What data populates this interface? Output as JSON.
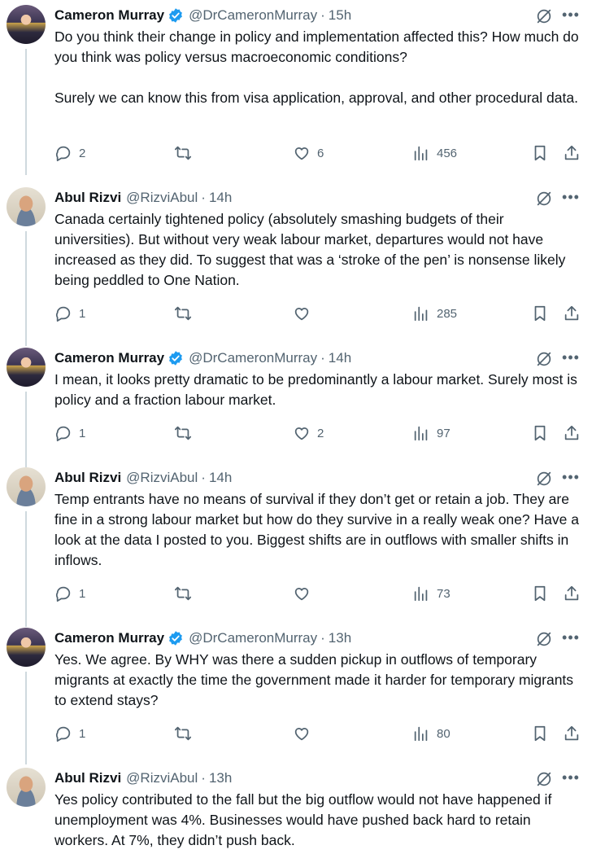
{
  "tweets": [
    {
      "name": "Cameron Murray",
      "verified": true,
      "handle": "@DrCameronMurray",
      "sep": "·",
      "time": "15h",
      "text": "Do you think their change in policy and implementation affected this? How much do you think was policy versus macroeconomic conditions?\n\nSurely we can know this from visa application, approval, and other procedural data.",
      "replies": "2",
      "reposts": "",
      "likes": "6",
      "views": "456"
    },
    {
      "name": "Abul Rizvi",
      "verified": false,
      "handle": "@RizviAbul",
      "sep": "·",
      "time": "14h",
      "text": "Canada certainly tightened policy (absolutely smashing budgets of their universities). But without very weak labour market, departures would not have increased as they did. To suggest that was a ‘stroke of the pen’ is nonsense likely being peddled to One Nation.",
      "replies": "1",
      "reposts": "",
      "likes": "",
      "views": "285"
    },
    {
      "name": "Cameron Murray",
      "verified": true,
      "handle": "@DrCameronMurray",
      "sep": "·",
      "time": "14h",
      "text": "I mean, it looks pretty dramatic to be predominantly a labour market. Surely most is policy and a fraction labour market.",
      "replies": "1",
      "reposts": "",
      "likes": "2",
      "views": "97"
    },
    {
      "name": "Abul Rizvi",
      "verified": false,
      "handle": "@RizviAbul",
      "sep": "·",
      "time": "14h",
      "text": "Temp entrants have no means of survival if they don’t get or retain a job. They are fine in a strong labour market but how do they survive in a really weak one? Have a look at the data I posted to you. Biggest shifts are in outflows with smaller shifts in inflows.",
      "replies": "1",
      "reposts": "",
      "likes": "",
      "views": "73"
    },
    {
      "name": "Cameron Murray",
      "verified": true,
      "handle": "@DrCameronMurray",
      "sep": "·",
      "time": "13h",
      "text": "Yes. We agree. By WHY was there a sudden pickup in outflows of temporary migrants at exactly the time the government made it harder for temporary migrants to extend stays?",
      "replies": "1",
      "reposts": "",
      "likes": "",
      "views": "80"
    },
    {
      "name": "Abul Rizvi",
      "verified": false,
      "handle": "@RizviAbul",
      "sep": "·",
      "time": "13h",
      "text": "Yes policy contributed to the fall but the big outflow would not have happened if unemployment was 4%. Businesses would have pushed back hard to retain workers. At 7%, they didn’t push back.",
      "replies": "",
      "reposts": "",
      "likes": "",
      "views": ""
    }
  ],
  "icons": {
    "more": "more-dots-icon",
    "grok": "grok-icon",
    "reply": "reply-icon",
    "repost": "repost-icon",
    "like": "heart-icon",
    "views": "views-chart-icon",
    "bookmark": "bookmark-icon",
    "share": "share-icon"
  },
  "colors": {
    "verified": "#1d9bf0",
    "secondary_text": "#536471",
    "thread_line": "#cfd9de"
  }
}
